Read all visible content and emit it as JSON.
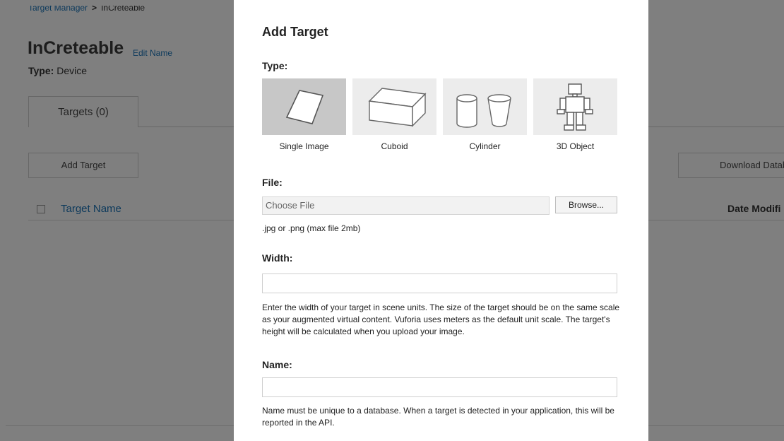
{
  "background": {
    "breadcrumb": {
      "parent": "Target Manager",
      "separator": ">",
      "current": "InCreteable"
    },
    "database_name": "InCreteable",
    "edit_name_link": "Edit Name",
    "type_label": "Type:",
    "type_value": "Device",
    "tab_targets": "Targets (0)",
    "add_target_button": "Add Target",
    "download_button": "Download Datab",
    "columns": {
      "target_name": "Target Name",
      "date_modified": "Date Modifi"
    }
  },
  "modal": {
    "title": "Add Target",
    "type_label": "Type:",
    "target_types": [
      {
        "label": "Single Image",
        "icon": "single-image-icon",
        "selected": true
      },
      {
        "label": "Cuboid",
        "icon": "cuboid-icon",
        "selected": false
      },
      {
        "label": "Cylinder",
        "icon": "cylinder-icon",
        "selected": false
      },
      {
        "label": "3D Object",
        "icon": "3d-object-icon",
        "selected": false
      }
    ],
    "file": {
      "label": "File:",
      "placeholder": "Choose File",
      "browse_button": "Browse...",
      "hint": ".jpg or .png (max file 2mb)"
    },
    "width": {
      "label": "Width:",
      "value": "",
      "hint": "Enter the width of your target in scene units. The size of the target should be on the same scale as your augmented virtual content. Vuforia uses meters as the default unit scale. The target's height will be calculated when you upload your image."
    },
    "name": {
      "label": "Name:",
      "value": "",
      "hint": "Name must be unique to a database. When a target is detected in your application, this will be reported in the API."
    }
  },
  "colors": {
    "link": "#1b74b8",
    "overlay": "rgba(0,0,0,0.5)",
    "selected_tile": "#c7c7c7",
    "tile": "#ececec"
  }
}
